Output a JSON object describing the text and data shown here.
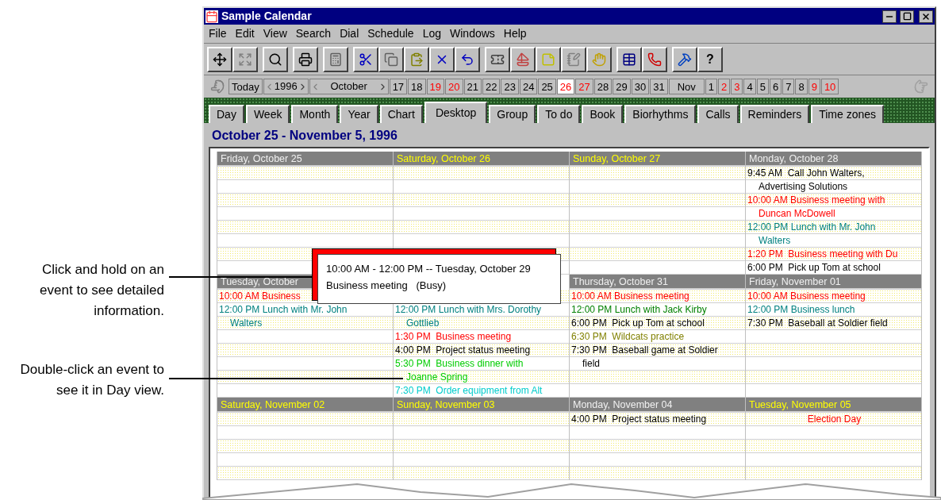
{
  "callouts": [
    {
      "text": "Click and hold on an event to see detailed information."
    },
    {
      "text": "Double-click an event to see it in Day view."
    }
  ],
  "window": {
    "title": "Sample Calendar"
  },
  "menu": [
    "File",
    "Edit",
    "View",
    "Search",
    "Dial",
    "Schedule",
    "Log",
    "Windows",
    "Help"
  ],
  "toolbar": {
    "help_label": "?"
  },
  "date_bar": {
    "today": "Today",
    "year": "1996",
    "month": "October",
    "next_month": "Nov",
    "days": [
      {
        "label": "17",
        "weekend": false,
        "selected": false
      },
      {
        "label": "18",
        "weekend": false,
        "selected": false
      },
      {
        "label": "19",
        "weekend": true,
        "selected": false
      },
      {
        "label": "20",
        "weekend": true,
        "selected": false
      },
      {
        "label": "21",
        "weekend": false,
        "selected": false
      },
      {
        "label": "22",
        "weekend": false,
        "selected": false
      },
      {
        "label": "23",
        "weekend": false,
        "selected": false
      },
      {
        "label": "24",
        "weekend": false,
        "selected": false
      },
      {
        "label": "25",
        "weekend": false,
        "selected": false
      },
      {
        "label": "26",
        "weekend": true,
        "selected": true
      },
      {
        "label": "27",
        "weekend": true,
        "selected": false
      },
      {
        "label": "28",
        "weekend": false,
        "selected": false
      },
      {
        "label": "29",
        "weekend": false,
        "selected": false
      },
      {
        "label": "30",
        "weekend": false,
        "selected": false
      },
      {
        "label": "31",
        "weekend": false,
        "selected": false
      }
    ],
    "next_days": [
      {
        "label": "1",
        "weekend": false,
        "selected": false
      },
      {
        "label": "2",
        "weekend": true,
        "selected": false
      },
      {
        "label": "3",
        "weekend": true,
        "selected": false
      },
      {
        "label": "4",
        "weekend": false,
        "selected": false
      },
      {
        "label": "5",
        "weekend": false,
        "selected": false
      },
      {
        "label": "6",
        "weekend": false,
        "selected": false
      },
      {
        "label": "7",
        "weekend": false,
        "selected": false
      },
      {
        "label": "8",
        "weekend": false,
        "selected": false
      },
      {
        "label": "9",
        "weekend": true,
        "selected": false
      },
      {
        "label": "10",
        "weekend": true,
        "selected": false
      }
    ]
  },
  "tabs": [
    {
      "label": "Day",
      "selected": false
    },
    {
      "label": "Week",
      "selected": false
    },
    {
      "label": "Month",
      "selected": false
    },
    {
      "label": "Year",
      "selected": false
    },
    {
      "label": "Chart",
      "selected": false
    },
    {
      "label": "Desktop",
      "selected": true
    },
    {
      "label": "Group",
      "selected": false
    },
    {
      "label": "To do",
      "selected": false
    },
    {
      "label": "Book",
      "selected": false
    },
    {
      "label": "Biorhythms",
      "selected": false
    },
    {
      "label": "Calls",
      "selected": false
    },
    {
      "label": "Reminders",
      "selected": false
    },
    {
      "label": "Time zones",
      "selected": false
    }
  ],
  "range_title": "October 25 - November 5, 1996",
  "weeks": [
    {
      "days": [
        {
          "header": "Friday, October 25",
          "highlighted": false
        },
        {
          "header": "Saturday, October 26",
          "highlighted": true
        },
        {
          "header": "Sunday, October 27",
          "highlighted": true
        },
        {
          "header": "Monday, October 28",
          "highlighted": false,
          "lines": [
            {
              "kind": "start",
              "text": "9:45 AM  Call John Walters,",
              "color": "#000000"
            },
            {
              "kind": "cont",
              "text": "Advertising Solutions",
              "color": "#000000"
            },
            {
              "kind": "start",
              "text": "10:00 AM Business meeting with",
              "color": "#ff0000"
            },
            {
              "kind": "cont",
              "text": "Duncan McDowell",
              "color": "#ff0000"
            },
            {
              "kind": "start",
              "text": "12:00 PM Lunch with Mr. John",
              "color": "#008080"
            },
            {
              "kind": "cont",
              "text": "Walters",
              "color": "#008080"
            },
            {
              "kind": "start",
              "text": "1:20 PM  Business meeting with Du",
              "color": "#ff0000"
            },
            {
              "kind": "start",
              "text": "6:00 PM  Pick up Tom at school",
              "color": "#000000"
            }
          ]
        }
      ]
    },
    {
      "days": [
        {
          "header": "Tuesday, October",
          "highlighted": false,
          "lines": [
            {
              "kind": "start",
              "text": "10:00 AM Business",
              "color": "#ff0000"
            },
            {
              "kind": "start",
              "text": "12:00 PM Lunch with Mr. John",
              "color": "#008080"
            },
            {
              "kind": "cont",
              "text": "Walters",
              "color": "#008080"
            }
          ]
        },
        {
          "lines": [
            {
              "kind": "blank"
            },
            {
              "kind": "start",
              "text": "12:00 PM Lunch with Mrs. Dorothy",
              "color": "#008080"
            },
            {
              "kind": "cont",
              "text": "Gottlieb",
              "color": "#008080"
            },
            {
              "kind": "start",
              "text": "1:30 PM  Business meeting",
              "color": "#ff0000"
            },
            {
              "kind": "start",
              "text": "4:00 PM  Project status meeting",
              "color": "#000000"
            },
            {
              "kind": "start",
              "text": "5:30 PM  Business dinner with",
              "color": "#00cc00"
            },
            {
              "kind": "cont",
              "text": "Joanne Spring",
              "color": "#00cc00"
            },
            {
              "kind": "start",
              "text": "7:30 PM  Order equipment from Alt",
              "color": "#00cccc"
            }
          ]
        },
        {
          "header": "Thursday, October 31",
          "highlighted": false,
          "lines": [
            {
              "kind": "start",
              "text": "10:00 AM Business meeting",
              "color": "#ff0000"
            },
            {
              "kind": "start",
              "text": "12:00 PM Lunch with Jack Kirby",
              "color": "#008000"
            },
            {
              "kind": "start",
              "text": "6:00 PM  Pick up Tom at school",
              "color": "#000000"
            },
            {
              "kind": "start",
              "text": "6:30 PM  Wildcats practice",
              "color": "#808000"
            },
            {
              "kind": "start",
              "text": "7:30 PM  Baseball game at Soldier",
              "color": "#000000"
            },
            {
              "kind": "cont",
              "text": "field",
              "color": "#000000"
            }
          ]
        },
        {
          "header": "Friday, November 01",
          "highlighted": false,
          "lines": [
            {
              "kind": "start",
              "text": "10:00 AM Business meeting",
              "color": "#ff0000"
            },
            {
              "kind": "start",
              "text": "12:00 PM Business lunch",
              "color": "#008080"
            },
            {
              "kind": "start",
              "text": "7:30 PM  Baseball at Soldier field",
              "color": "#000000"
            }
          ]
        }
      ]
    },
    {
      "days": [
        {
          "header": "Saturday, November 02",
          "highlighted": true
        },
        {
          "header": "Sunday, November 03",
          "highlighted": true
        },
        {
          "header": "Monday, November 04",
          "highlighted": false,
          "lines": [
            {
              "kind": "start",
              "text": "4:00 PM  Project status meeting",
              "color": "#000000"
            }
          ]
        },
        {
          "header": "Tuesday, November 05",
          "highlighted": true,
          "lines": [
            {
              "kind": "center",
              "text": "Election Day",
              "color": "#ff0000"
            }
          ]
        }
      ]
    }
  ],
  "tooltip": {
    "line1": "10:00 AM - 12:00 PM -- Tuesday, October 29",
    "line2": "Business meeting   (Busy)"
  }
}
